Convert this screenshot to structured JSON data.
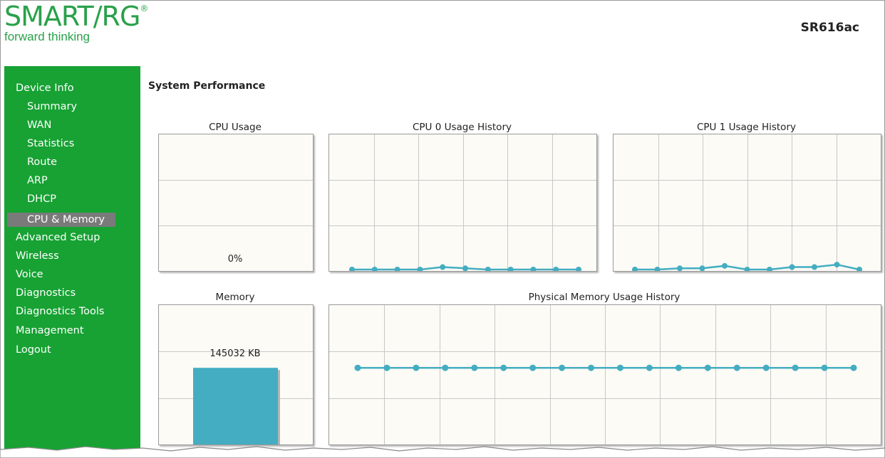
{
  "header": {
    "logo_text": "SMART/RG",
    "logo_mark": "®",
    "tagline": "forward thinking",
    "model": "SR616ac"
  },
  "sidebar": {
    "items": [
      {
        "label": "Device Info",
        "level": 0
      },
      {
        "label": "Summary",
        "level": 1
      },
      {
        "label": "WAN",
        "level": 1
      },
      {
        "label": "Statistics",
        "level": 1
      },
      {
        "label": "Route",
        "level": 1
      },
      {
        "label": "ARP",
        "level": 1
      },
      {
        "label": "DHCP",
        "level": 1
      },
      {
        "label": "CPU & Memory",
        "level": 1,
        "active": true
      },
      {
        "label": "Advanced Setup",
        "level": 0
      },
      {
        "label": "Wireless",
        "level": 0
      },
      {
        "label": "Voice",
        "level": 0
      },
      {
        "label": "Diagnostics",
        "level": 0
      },
      {
        "label": "Diagnostics Tools",
        "level": 0
      },
      {
        "label": "Management",
        "level": 0
      },
      {
        "label": "Logout",
        "level": 0
      }
    ]
  },
  "main": {
    "title": "System Performance",
    "cpu_usage": {
      "title": "CPU Usage",
      "value_label": "0%",
      "value": 0
    },
    "cpu0_history": {
      "title": "CPU 0 Usage History",
      "values": [
        0,
        0,
        0,
        0,
        2,
        1,
        0,
        0,
        0,
        0,
        0
      ]
    },
    "cpu1_history": {
      "title": "CPU 1 Usage History",
      "values": [
        0,
        0,
        1,
        1,
        3,
        0,
        0,
        2,
        2,
        4,
        0
      ]
    },
    "memory": {
      "title": "Memory",
      "value_label": "145032 KB",
      "fill_fraction": 0.55
    },
    "mem_history": {
      "title": "Physical Memory Usage History",
      "level_fraction": 0.55,
      "points": 18
    }
  },
  "colors": {
    "brand_green": "#17a233",
    "logo_green": "#2aa14a",
    "active_nav": "#7a7a7a",
    "series": "#44adc1",
    "chart_bg": "#fcfbf6",
    "grid": "#c8c8c8"
  }
}
